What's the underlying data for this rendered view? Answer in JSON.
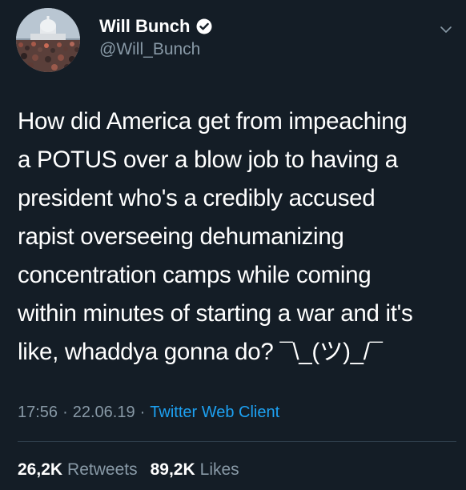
{
  "author": {
    "display_name": "Will Bunch",
    "handle": "@Will_Bunch",
    "verified": true
  },
  "tweet": {
    "lines": [
      "How did America get from impeaching",
      "a POTUS over a blow job to having a",
      "president who's a credibly accused",
      "rapist overseeing dehumanizing",
      "concentration camps while coming",
      "within minutes of starting a war and it's",
      "like, whaddya gonna do? ¯\\_(ツ)_/¯"
    ]
  },
  "meta": {
    "time": "17:56",
    "separator1": "·",
    "date": "22.06.19",
    "separator2": "·",
    "client": "Twitter Web Client"
  },
  "stats": {
    "retweets_count": "26,2K",
    "retweets_label": "Retweets",
    "likes_count": "89,2K",
    "likes_label": "Likes"
  },
  "colors": {
    "background": "#141d26",
    "text": "#ffffff",
    "secondary": "#8899a6",
    "accent": "#1da1f2"
  },
  "icons": [
    "verified-icon",
    "chevron-down-icon"
  ]
}
